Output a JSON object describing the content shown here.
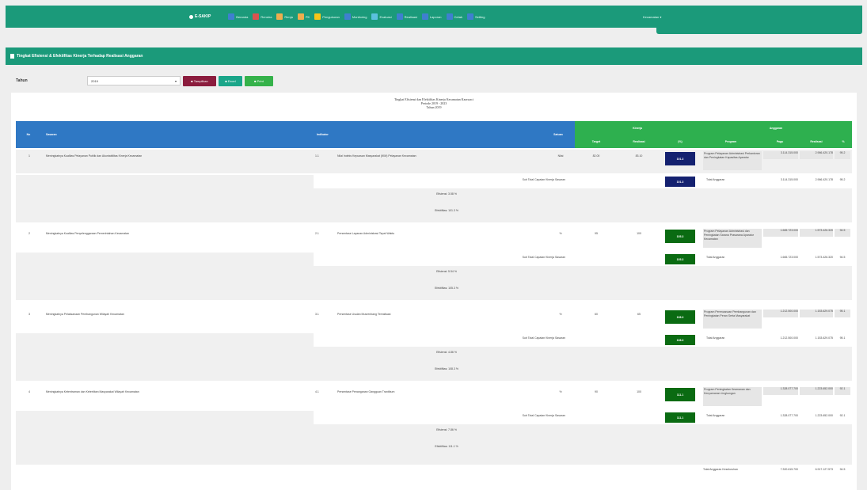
{
  "nav": {
    "brand": "E-SAKIP",
    "items": [
      {
        "label": "Beranda",
        "color": "#3f7fd0"
      },
      {
        "label": "Renstra",
        "color": "#d9534f"
      },
      {
        "label": "Renja",
        "color": "#f0ad4e"
      },
      {
        "label": "PK",
        "color": "#f0ad4e"
      },
      {
        "label": "Pengukuran",
        "color": "#f5c518"
      },
      {
        "label": "Monitoring",
        "color": "#3f7fd0"
      },
      {
        "label": "Evaluasi",
        "color": "#5bc0de"
      },
      {
        "label": "Realisasi",
        "color": "#3f7fd0"
      },
      {
        "label": "Laporan",
        "color": "#3f7fd0"
      },
      {
        "label": "Cetak",
        "color": "#3f7fd0"
      },
      {
        "label": "Setting",
        "color": "#3f7fd0"
      }
    ],
    "user": "Kecamatan"
  },
  "panel_title": "Tingkat Efisiensi & Efektifitas Kinerja Terhadap Realisasi Anggaran",
  "filter": {
    "label": "Tahun",
    "selected": "2019",
    "buttons": [
      {
        "label": "Tampilkan",
        "color": "#8b1c3d"
      },
      {
        "label": "Excel",
        "color": "#1aa689"
      },
      {
        "label": "Print",
        "color": "#35b24a"
      }
    ]
  },
  "report_title": [
    "Tingkat Efisiensi dan Efektifitas Kinerja Kecamatan Karawaci",
    "Periode 2019 - 2023",
    "Tahun 2019"
  ],
  "headers": {
    "no": "No",
    "sasaran": "Sasaran",
    "indikator": "Indikator",
    "satuan": "Satuan",
    "kinerja": "Kinerja",
    "target": "Target",
    "realisasi": "Realisasi",
    "pk": "(%)",
    "anggaran": "Anggaran",
    "program": "Program",
    "pagu": "Pagu",
    "realisasi_ang": "Realisasi",
    "persen": "%"
  },
  "rows": [
    {
      "no": "1",
      "sasaran": "Meningkatnya Kualitas Pelayanan Publik dan Akuntabilitas Kinerja Kecamatan",
      "kode": "1.1",
      "indikator": "Nilai Indeks Kepuasan Masyarakat (IKM) Pelayanan Kecamatan",
      "satuan": "Nilai",
      "target": "82.00",
      "realisasi": "83.10",
      "pk": "101.3",
      "pk_color": "navy",
      "program": "Program Pelayanan Administrasi Perkantoran dan Peningkatan Kapasitas Aparatur",
      "pagu": "3.114.315.000",
      "real": "2.966.420.178",
      "persen": "95.2",
      "sub_label": "Sub Total Capaian Kinerja Sasaran",
      "sub_pk": "101.3",
      "sub_program": "Total Anggaran",
      "sub_pagu": "3.114.315.000",
      "sub_real": "2.966.420.178",
      "sub_persen": "95.2",
      "ef": "Efisiensi: 3.58 %",
      "efk": "Efektifitas: 101.3 %"
    },
    {
      "no": "2",
      "sasaran": "Meningkatnya Kualitas Penyelenggaraan Pemerintahan Kecamatan",
      "kode": "2.1",
      "indikator": "Persentase Layanan Administrasi Tepat Waktu",
      "satuan": "%",
      "target": "95",
      "realisasi": "100",
      "pk": "105.3",
      "pk_color": "dgreen",
      "program": "Program Pelayanan Administrasi dan Peningkatan Sarana Prasarana Aparatur Kecamatan",
      "pagu": "1.665.723.000",
      "real": "1.573.426.320",
      "persen": "94.5",
      "sub_label": "Sub Total Capaian Kinerja Sasaran",
      "sub_pk": "105.3",
      "sub_program": "Total Anggaran",
      "sub_pagu": "1.665.723.000",
      "sub_real": "1.573.426.320",
      "sub_persen": "94.5",
      "ef": "Efisiensi: 5.54 %",
      "efk": "Efektifitas: 105.3 %"
    },
    {
      "no": "3",
      "sasaran": "Meningkatnya Pelaksanaan Pembangunan Wilayah Kecamatan",
      "kode": "3.1",
      "indikator": "Persentase Usulan Musrenbang Terealisasi",
      "satuan": "%",
      "target": "60",
      "realisasi": "65",
      "pk": "108.3",
      "pk_color": "dgreen",
      "program": "Program Perencanaan Pembangunan dan Peningkatan Peran Serta Masyarakat",
      "pagu": "1.212.500.000",
      "real": "1.153.629.075",
      "persen": "95.1",
      "sub_label": "Sub Total Capaian Kinerja Sasaran",
      "sub_pk": "108.3",
      "sub_program": "Total Anggaran",
      "sub_pagu": "1.212.500.000",
      "sub_real": "1.153.629.075",
      "sub_persen": "95.1",
      "ef": "Efisiensi: 4.86 %",
      "efk": "Efektifitas: 108.3 %"
    },
    {
      "no": "4",
      "sasaran": "Meningkatnya Ketentraman dan Ketertiban Masyarakat Wilayah Kecamatan",
      "kode": "4.1",
      "indikator": "Persentase Penanganan Gangguan Trantibum",
      "satuan": "%",
      "target": "90",
      "realisasi": "100",
      "pk": "111.1",
      "pk_color": "dgreen",
      "program": "Program Peningkatan Keamanan dan Kenyamanan Lingkungan",
      "pagu": "1.328.077.700",
      "real": "1.223.652.000",
      "persen": "92.1",
      "sub_label": "Sub Total Capaian Kinerja Sasaran",
      "sub_pk": "111.1",
      "sub_program": "Total Anggaran",
      "sub_pagu": "1.328.077.700",
      "sub_real": "1.223.652.000",
      "sub_persen": "92.1",
      "ef": "Efisiensi: 7.86 %",
      "efk": "Efektifitas: 111.1 %"
    }
  ],
  "grand": {
    "label": "Total Anggaran Keseluruhan",
    "pagu": "7.320.615.700",
    "real": "6.917.127.573",
    "persen": "94.5"
  }
}
